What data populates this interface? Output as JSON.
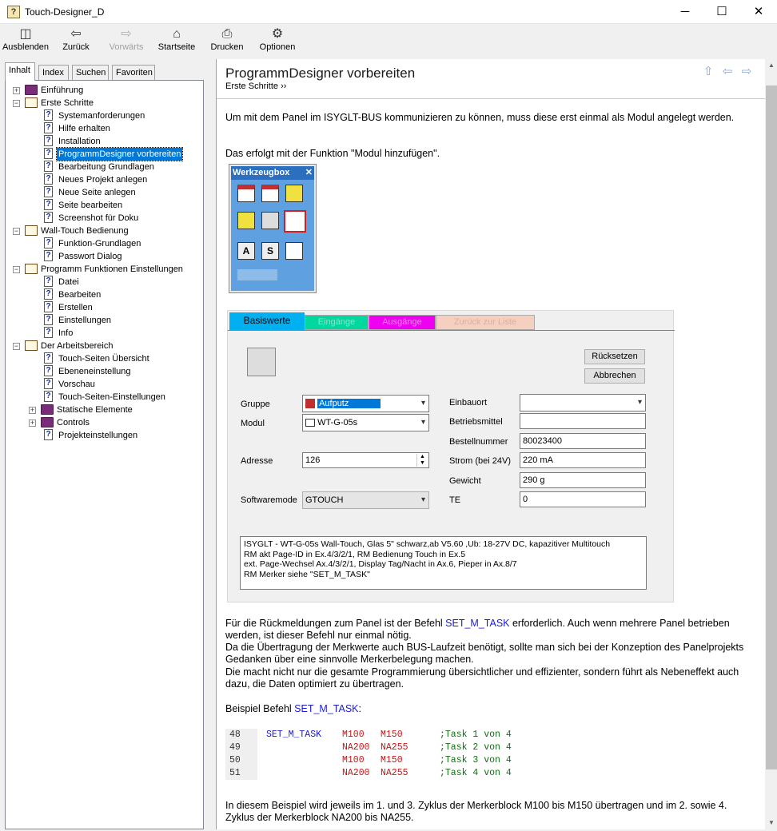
{
  "window": {
    "title": "Touch-Designer_D",
    "controls": {
      "minimize": "─",
      "maximize": "☐",
      "close": "✕"
    }
  },
  "toolbar": [
    {
      "label": "Ausblenden",
      "icon": "◫",
      "disabled": false
    },
    {
      "label": "Zurück",
      "icon": "⇦",
      "disabled": false
    },
    {
      "label": "Vorwärts",
      "icon": "⇨",
      "disabled": true
    },
    {
      "label": "Startseite",
      "icon": "⌂",
      "disabled": false
    },
    {
      "label": "Drucken",
      "icon": "⎙",
      "disabled": false
    },
    {
      "label": "Optionen",
      "icon": "⚙",
      "disabled": false
    }
  ],
  "nav_tabs": [
    {
      "label": "Inhalt"
    },
    {
      "label": "Index"
    },
    {
      "label": "Suchen"
    },
    {
      "label": "Favoriten"
    }
  ],
  "tree": [
    {
      "label": "Einführung",
      "level": 0,
      "type": "book-closed",
      "exp": "+"
    },
    {
      "label": "Erste Schritte",
      "level": 0,
      "type": "book-open",
      "exp": "−"
    },
    {
      "label": "Systemanforderungen",
      "level": 1,
      "type": "page"
    },
    {
      "label": "Hilfe erhalten",
      "level": 1,
      "type": "page"
    },
    {
      "label": "Installation",
      "level": 1,
      "type": "page"
    },
    {
      "label": "ProgrammDesigner vorbereiten",
      "level": 1,
      "type": "page",
      "selected": true
    },
    {
      "label": "Bearbeitung Grundlagen",
      "level": 1,
      "type": "page"
    },
    {
      "label": "Neues Projekt anlegen",
      "level": 1,
      "type": "page"
    },
    {
      "label": "Neue Seite anlegen",
      "level": 1,
      "type": "page"
    },
    {
      "label": "Seite bearbeiten",
      "level": 1,
      "type": "page"
    },
    {
      "label": "Screenshot für Doku",
      "level": 1,
      "type": "page"
    },
    {
      "label": "Wall-Touch Bedienung",
      "level": 0,
      "type": "book-open",
      "exp": "−"
    },
    {
      "label": "Funktion-Grundlagen",
      "level": 1,
      "type": "page"
    },
    {
      "label": "Passwort Dialog",
      "level": 1,
      "type": "page"
    },
    {
      "label": "Programm Funktionen Einstellungen",
      "level": 0,
      "type": "book-open",
      "exp": "−"
    },
    {
      "label": "Datei",
      "level": 1,
      "type": "page"
    },
    {
      "label": "Bearbeiten",
      "level": 1,
      "type": "page"
    },
    {
      "label": "Erstellen",
      "level": 1,
      "type": "page"
    },
    {
      "label": "Einstellungen",
      "level": 1,
      "type": "page"
    },
    {
      "label": "Info",
      "level": 1,
      "type": "page"
    },
    {
      "label": "Der Arbeitsbereich",
      "level": 0,
      "type": "book-open",
      "exp": "−"
    },
    {
      "label": "Touch-Seiten Übersicht",
      "level": 1,
      "type": "page"
    },
    {
      "label": "Ebeneneinstellung",
      "level": 1,
      "type": "page"
    },
    {
      "label": "Vorschau",
      "level": 1,
      "type": "page"
    },
    {
      "label": "Touch-Seiten-Einstellungen",
      "level": 1,
      "type": "page"
    },
    {
      "label": "Statische Elemente",
      "level": 1,
      "type": "book-closed",
      "exp": "+"
    },
    {
      "label": "Controls",
      "level": 1,
      "type": "book-closed",
      "exp": "+"
    },
    {
      "label": "Projekteinstellungen",
      "level": 1,
      "type": "page"
    }
  ],
  "page": {
    "title": "ProgrammDesigner vorbereiten",
    "breadcrumb": "Erste Schritte ››",
    "p1": "Um mit dem Panel im ISYGLT-BUS kommunizieren zu können, muss diese erst einmal als Modul angelegt werden.",
    "p2": "Das erfolgt mit der Funktion \"Modul hinzufügen\".",
    "p3_before": "Für die Rückmeldungen zum Panel ist der Befehl ",
    "p3_link": "SET_M_TASK",
    "p3_after": " erforderlich. Auch wenn mehrere Panel betrieben werden, ist dieser Befehl nur einmal nötig.",
    "p4": "Da die Übertragung der Merkwerte auch BUS-Laufzeit benötigt, sollte man sich bei der Konzeption des Panelprojekts Gedanken über eine sinnvolle Merkerbelegung machen.",
    "p5": "Die macht nicht nur die gesamte Programmierung übersichtlicher und effizienter, sondern führt als Nebeneffekt auch dazu, die Daten optimiert zu übertragen.",
    "p6_before": "Beispiel Befehl ",
    "p6_link": "SET_M_TASK",
    "p6_after": ":",
    "p7": "In diesem Beispiel wird jeweils im 1. und 3. Zyklus der Merkerblock M100 bis M150 übertragen und im 2. sowie 4. Zyklus der Merkerblock NA200 bis NA255."
  },
  "werkzeugbox": {
    "title": "Werkzeugbox",
    "close": "✕"
  },
  "form": {
    "tabs": [
      "Basiswerte",
      "Eingänge",
      "Ausgänge",
      "Zurück zur Liste"
    ],
    "reset": "Rücksetzen",
    "cancel": "Abbrechen",
    "gruppe_label": "Gruppe",
    "gruppe_value": "Aufputz",
    "modul_label": "Modul",
    "modul_value": "WT-G-05s",
    "adresse_label": "Adresse",
    "adresse_value": "126",
    "softwaremode_label": "Softwaremode",
    "softwaremode_value": "GTOUCH",
    "einbauort_label": "Einbauort",
    "einbauort_value": "",
    "betriebsmittel_label": "Betriebsmittel",
    "betriebsmittel_value": "",
    "bestellnummer_label": "Bestellnummer",
    "bestellnummer_value": "80023400",
    "strom_label": "Strom (bei 24V)",
    "strom_value": "220 mA",
    "gewicht_label": "Gewicht",
    "gewicht_value": "290 g",
    "te_label": "TE",
    "te_value": "0",
    "memo": [
      "ISYGLT - WT-G-05s Wall-Touch, Glas 5\" schwarz,ab V5.60 ,Ub: 18-27V DC, kapazitiver Multitouch",
      "RM akt Page-ID in Ex.4/3/2/1, RM Bedienung Touch in Ex.5",
      "ext. Page-Wechsel Ax.4/3/2/1, Display Tag/Nacht in Ax.6, Pieper in Ax.8/7",
      "RM Merker siehe \"SET_M_TASK\""
    ]
  },
  "code": [
    {
      "ln": "48",
      "cmd": "SET_M_TASK",
      "a": "M100 ",
      "b": "M150 ",
      "c": ";Task 1 von 4"
    },
    {
      "ln": "49",
      "cmd": "",
      "a": "NA200",
      "b": "NA255",
      "c": ";Task 2 von 4"
    },
    {
      "ln": "50",
      "cmd": "",
      "a": "M100 ",
      "b": "M150 ",
      "c": ";Task 3 von 4"
    },
    {
      "ln": "51",
      "cmd": "",
      "a": "NA200",
      "b": "NA255",
      "c": ";Task 4 von 4"
    }
  ]
}
